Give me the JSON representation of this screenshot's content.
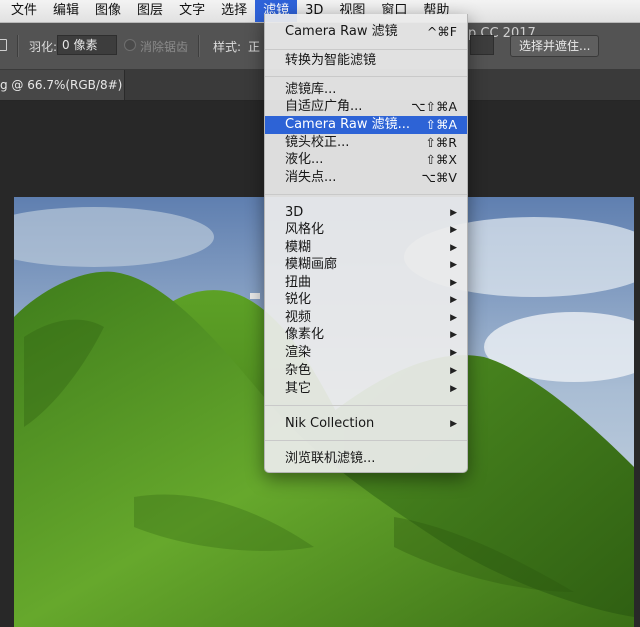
{
  "menubar": {
    "items": [
      "文件",
      "编辑",
      "图像",
      "图层",
      "文字",
      "选择",
      "滤镜",
      "3D",
      "视图",
      "窗口",
      "帮助"
    ],
    "active": "滤镜"
  },
  "options": {
    "feather_label": "羽化:",
    "feather_value": "0 像素",
    "antialias_label": "消除锯齿",
    "style_label": "样式:",
    "style_value": "正",
    "select_mask_button": "选择并遮住...",
    "app_title_fragment": "p CC 2017"
  },
  "document": {
    "tab_label": "g @ 66.7%(RGB/8#) *"
  },
  "filter_menu": {
    "group1": [
      {
        "label": "Camera Raw 滤镜",
        "shortcut": "^⌘F"
      }
    ],
    "group2": [
      {
        "label": "转换为智能滤镜",
        "shortcut": ""
      }
    ],
    "group3": [
      {
        "label": "滤镜库...",
        "shortcut": ""
      },
      {
        "label": "自适应广角...",
        "shortcut": "⌥⇧⌘A"
      },
      {
        "label": "Camera Raw 滤镜...",
        "shortcut": "⇧⌘A"
      },
      {
        "label": "镜头校正...",
        "shortcut": "⇧⌘R"
      },
      {
        "label": "液化...",
        "shortcut": "⇧⌘X"
      },
      {
        "label": "消失点...",
        "shortcut": "⌥⌘V"
      }
    ],
    "highlighted": "Camera Raw 滤镜...",
    "group4": [
      {
        "label": "3D"
      },
      {
        "label": "风格化"
      },
      {
        "label": "模糊"
      },
      {
        "label": "模糊画廊"
      },
      {
        "label": "扭曲"
      },
      {
        "label": "锐化"
      },
      {
        "label": "视频"
      },
      {
        "label": "像素化"
      },
      {
        "label": "渲染"
      },
      {
        "label": "杂色"
      },
      {
        "label": "其它"
      }
    ],
    "group5": [
      {
        "label": "Nik Collection"
      }
    ],
    "group6": [
      {
        "label": "浏览联机滤镜..."
      }
    ],
    "submenu_arrow": "▶"
  },
  "colors": {
    "highlight": "#2d63d6",
    "menubar_active": "#2e62d9"
  }
}
